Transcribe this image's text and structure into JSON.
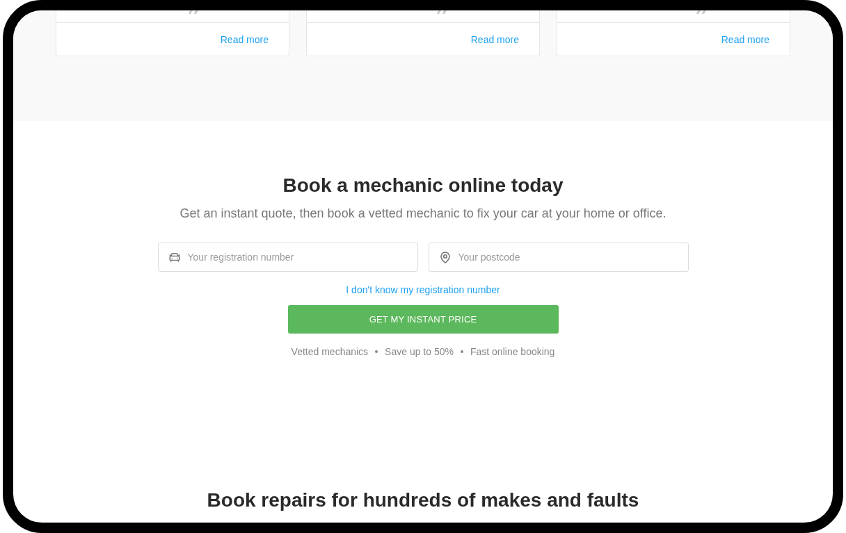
{
  "testimonials": {
    "cards": [
      {
        "link": "Read more"
      },
      {
        "link": "Read more"
      },
      {
        "link": "Read more"
      }
    ]
  },
  "booking": {
    "title": "Book a mechanic online today",
    "subtitle": "Get an instant quote, then book a vetted mechanic to fix your car at your home or office.",
    "fields": [
      {
        "kind": "registration",
        "placeholder": "Your registration number"
      },
      {
        "kind": "postcode",
        "placeholder": "Your postcode"
      }
    ],
    "help_link": "I don't know my registration number",
    "button": "GET MY INSTANT PRICE",
    "features": [
      "Vetted mechanics",
      "Save up to 50%",
      "Fast online booking"
    ]
  },
  "makes_section": {
    "title": "Book repairs for hundreds of makes and faults"
  }
}
